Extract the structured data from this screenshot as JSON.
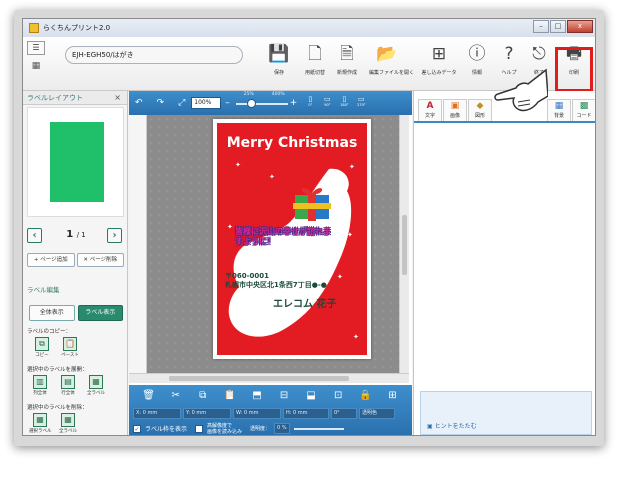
{
  "window": {
    "title": "らくちんプリント2.0",
    "minimize": "–",
    "maximize": "□",
    "close": "x"
  },
  "toolbar": {
    "model": "EJH-EGH50/はがき",
    "buttons": [
      {
        "label": "保存",
        "icon": "save-icon"
      },
      {
        "label": "用紙切替",
        "icon": "paper-switch-icon"
      },
      {
        "label": "新規作成",
        "icon": "new-file-icon"
      },
      {
        "label": "編集ファイルを開く",
        "icon": "open-file-icon"
      },
      {
        "label": "差し込みデータ",
        "icon": "merge-data-icon"
      },
      {
        "label": "情報",
        "icon": "info-icon"
      },
      {
        "label": "ヘルプ",
        "icon": "help-icon"
      },
      {
        "label": "終了",
        "icon": "exit-icon"
      },
      {
        "label": "印刷",
        "icon": "print-icon"
      }
    ]
  },
  "left_panel": {
    "title": "ラベルレイアウト",
    "close": "×",
    "page": "1",
    "page_total": "/ 1",
    "add_page": "ページ追加",
    "delete_page": "ページ削除",
    "edit_section": "ラベル編集",
    "view_all": "全体表示",
    "view_label": "ラベル表示",
    "copy_section": "ラベルのコピー：",
    "copy": "コピー",
    "paste": "ペースト",
    "expand_section": "選択中のラベルを展開：",
    "expand_buttons": [
      "列全体",
      "行全体",
      "全ラベル"
    ],
    "delete_section": "選択中のラベルを削除：",
    "delete_buttons": [
      "選択ラベル",
      "全ラベル"
    ]
  },
  "canvas": {
    "zoom": "100%",
    "zoom_min_label": "25%",
    "zoom_max_label": "400%",
    "zoom_fraction": 0.25,
    "rotations": [
      "0°",
      "90°",
      "180°",
      "270°"
    ],
    "card": {
      "title": "Merry Christmas",
      "greeting": "皆様に沢山の幸せが訪れますように！",
      "zip": "〒060-0001",
      "address": "札幌市中央区北1条西7丁目●-●",
      "name": "エレコム 花子"
    }
  },
  "bottom_bar": {
    "x": "X:   0 mm",
    "y": "Y:   0 mm",
    "w": "W:   0 mm",
    "h": "H:   0 mm",
    "angle": "0°",
    "transparent_color": "透明色",
    "show_frame": "ラベル枠を表示",
    "hi_res_line1": "高解像度で",
    "hi_res_line2": "画像を読み込み",
    "transparency": "透明度：",
    "transparency_value": "0 %"
  },
  "right_panel": {
    "tabs": [
      {
        "label": "文字",
        "glyph": "A",
        "color": "#c0282c"
      },
      {
        "label": "画像",
        "glyph": "▣",
        "color": "#e07020"
      },
      {
        "label": "図形",
        "glyph": "◆",
        "color": "#c09020"
      },
      {
        "label": "背景",
        "glyph": "▦",
        "color": "#3a7ac0"
      },
      {
        "label": "コード",
        "glyph": "▩",
        "color": "#2a8a5a"
      }
    ],
    "hint": "ヒントをたたむ"
  }
}
